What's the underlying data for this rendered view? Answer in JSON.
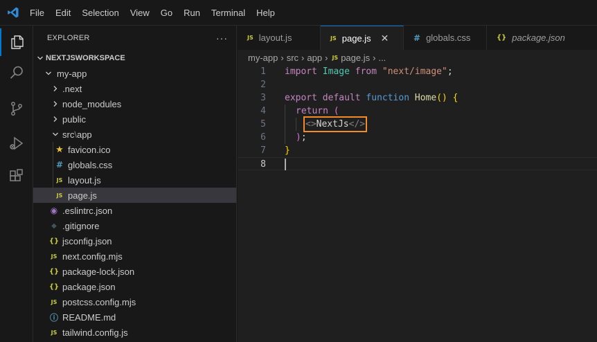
{
  "menu": [
    "File",
    "Edit",
    "Selection",
    "View",
    "Go",
    "Run",
    "Terminal",
    "Help"
  ],
  "activity": [
    "explorer-icon",
    "search-icon",
    "source-control-icon",
    "run-debug-icon",
    "extensions-icon"
  ],
  "explorer": {
    "title": "EXPLORER",
    "more": "···",
    "workspace": "NEXTJSWORKSPACE",
    "items": [
      {
        "label": "my-app",
        "chev": "⌄"
      },
      {
        "label": ".next",
        "chev": "›"
      },
      {
        "label": "node_modules",
        "chev": "›"
      },
      {
        "label": "public",
        "chev": "›"
      },
      {
        "label": "src",
        "sep": "\\",
        "label2": "app",
        "chev": "⌄"
      },
      {
        "label": "favicon.ico",
        "icon": "★"
      },
      {
        "label": "globals.css",
        "icon": "#"
      },
      {
        "label": "layout.js",
        "icon": "JS"
      },
      {
        "label": "page.js",
        "icon": "JS"
      },
      {
        "label": ".eslintrc.json",
        "icon": "◉"
      },
      {
        "label": ".gitignore",
        "icon": "◆"
      },
      {
        "label": "jsconfig.json",
        "icon": "{}"
      },
      {
        "label": "next.config.mjs",
        "icon": "JS"
      },
      {
        "label": "package-lock.json",
        "icon": "{}"
      },
      {
        "label": "package.json",
        "icon": "{}"
      },
      {
        "label": "postcss.config.mjs",
        "icon": "JS"
      },
      {
        "label": "README.md",
        "icon": "ⓘ"
      },
      {
        "label": "tailwind.config.js",
        "icon": "JS"
      }
    ]
  },
  "tabs": [
    {
      "label": "layout.js",
      "icon": "JS"
    },
    {
      "label": "page.js",
      "icon": "JS",
      "close": "✕"
    },
    {
      "label": "globals.css",
      "icon": "#"
    },
    {
      "label": "package.json",
      "icon": "{}"
    }
  ],
  "breadcrumbs": {
    "c1": "my-app",
    "c2": "src",
    "c3": "app",
    "c4": "page.js",
    "c5": "...",
    "icon": "JS",
    "sep": "›"
  },
  "code": {
    "line_numbers": [
      "1",
      "2",
      "3",
      "4",
      "5",
      "6",
      "7",
      "8"
    ],
    "l1": {
      "import": "import",
      "image": "Image",
      "from": "from",
      "str": "\"next/image\"",
      "semi": ";"
    },
    "l3": {
      "export": "export",
      "default": "default",
      "function": "function",
      "name": "Home",
      "parens": "()",
      "brace": "{"
    },
    "l4": {
      "return": "return",
      "paren": "("
    },
    "l5": {
      "open": "<>",
      "text": "NextJs",
      "close": "</>"
    },
    "l6": {
      "paren": ")",
      "semi": ";"
    },
    "l7": {
      "brace": "}"
    }
  },
  "colors": {
    "accent": "#0078d4",
    "highlight_box": "#f28c28",
    "js_icon": "#cbcb41",
    "css_icon": "#519aba",
    "json_icon": "#cbcb41"
  }
}
